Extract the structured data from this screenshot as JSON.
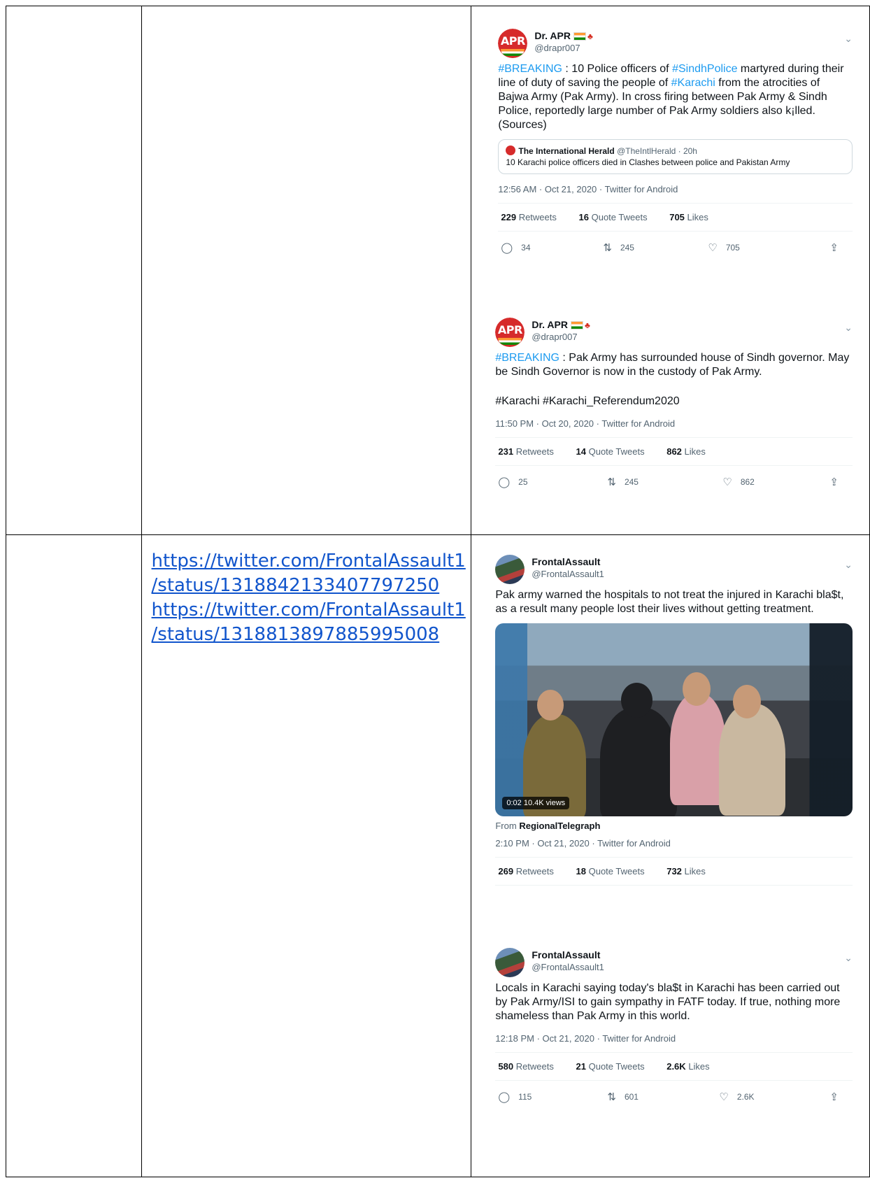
{
  "row2": {
    "links": [
      "https://twitter.com/FrontalAssault1",
      "/status/1318842133407797250",
      "https://twitter.com/FrontalAssault1",
      "/status/1318813897885995008"
    ]
  },
  "tweets": [
    {
      "name": "Dr. APR",
      "handle": "@drapr007",
      "text_parts": [
        "#BREAKING",
        " : 10 Police officers of ",
        "#SindhPolice",
        " martyred during their line of duty of saving the people of ",
        "#Karachi",
        " from the atrocities of Bajwa Army (Pak Army). In cross firing between Pak Army & Sindh Police, reportedly large number of Pak Army soldiers also k¡lled."
      ],
      "line2": "(Sources)",
      "quote": {
        "name": "The International Herald",
        "handle": "@TheIntlHerald · 20h",
        "text": "10 Karachi police officers died in Clashes between police and Pakistan Army"
      },
      "meta": "12:56 AM · Oct 21, 2020 · Twitter for Android",
      "retweets": "229",
      "retweets_label": "Retweets",
      "quotes": "16",
      "quotes_label": "Quote Tweets",
      "likes": "705",
      "likes_label": "Likes",
      "reply_count": "34",
      "rt_count": "245",
      "like_count": "705"
    },
    {
      "name": "Dr. APR",
      "handle": "@drapr007",
      "text_parts": [
        "#BREAKING",
        " : Pak Army has surrounded house of Sindh governor. May be Sindh Governor is now in the custody of Pak Army."
      ],
      "tags": "#Karachi #Karachi_Referendum2020",
      "meta": "11:50 PM · Oct 20, 2020 · Twitter for Android",
      "retweets": "231",
      "retweets_label": "Retweets",
      "quotes": "14",
      "quotes_label": "Quote Tweets",
      "likes": "862",
      "likes_label": "Likes",
      "reply_count": "25",
      "rt_count": "245",
      "like_count": "862"
    },
    {
      "name": "FrontalAssault",
      "handle": "@FrontalAssault1",
      "text": "Pak army warned the hospitals to not treat the injured in Karachi bla$t, as a result many people lost their lives without getting treatment.",
      "video_badge": "0:02  10.4K views",
      "from_prefix": "From",
      "from_name": "RegionalTelegraph",
      "meta": "2:10 PM · Oct 21, 2020 · Twitter for Android",
      "retweets": "269",
      "retweets_label": "Retweets",
      "quotes": "18",
      "quotes_label": "Quote Tweets",
      "likes": "732",
      "likes_label": "Likes"
    },
    {
      "name": "FrontalAssault",
      "handle": "@FrontalAssault1",
      "text": "Locals in Karachi saying today's bla$t in Karachi has been carried out by Pak Army/ISI to gain sympathy in FATF today. If true, nothing more shameless than Pak Army in this world.",
      "meta": "12:18 PM · Oct 21, 2020 · Twitter for Android",
      "retweets": "580",
      "retweets_label": "Retweets",
      "quotes": "21",
      "quotes_label": "Quote Tweets",
      "likes": "2.6K",
      "likes_label": "Likes",
      "reply_count": "115",
      "rt_count": "601",
      "like_count": "2.6K"
    }
  ]
}
